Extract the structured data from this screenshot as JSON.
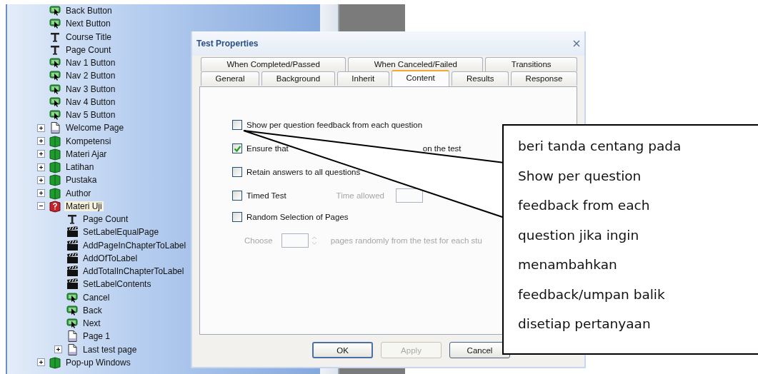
{
  "tree": {
    "items": [
      {
        "label": "Back Button",
        "kind": "button",
        "selected": false
      },
      {
        "label": "Next Button",
        "kind": "button",
        "selected": false
      },
      {
        "label": "Course Title",
        "kind": "text",
        "selected": false
      },
      {
        "label": "Page Count",
        "kind": "text",
        "selected": false
      },
      {
        "label": "Nav 1 Button",
        "kind": "button",
        "selected": false
      },
      {
        "label": "Nav 2 Button",
        "kind": "button",
        "selected": false
      },
      {
        "label": "Nav 3 Button",
        "kind": "button",
        "selected": false
      },
      {
        "label": "Nav 4 Button",
        "kind": "button",
        "selected": false
      },
      {
        "label": "Nav 5 Button",
        "kind": "button",
        "selected": false
      },
      {
        "label": "Welcome Page",
        "kind": "page",
        "expanded": false,
        "selected": false
      },
      {
        "label": "Kompetensi",
        "kind": "chapter",
        "expanded": false,
        "selected": false
      },
      {
        "label": "Materi Ajar",
        "kind": "chapter",
        "expanded": false,
        "selected": false
      },
      {
        "label": "Latihan",
        "kind": "chapter",
        "expanded": false,
        "selected": false
      },
      {
        "label": "Pustaka",
        "kind": "chapter",
        "expanded": false,
        "selected": false
      },
      {
        "label": "Author",
        "kind": "chapter",
        "expanded": false,
        "selected": false
      },
      {
        "label": "Materi Uji",
        "kind": "test",
        "expanded": true,
        "selected": true,
        "children": [
          {
            "label": "Page Count",
            "kind": "text",
            "selected": false
          },
          {
            "label": "SetLabelEqualPage",
            "kind": "action",
            "selected": false
          },
          {
            "label": "AddPageInChapterToLabel",
            "kind": "action",
            "selected": false
          },
          {
            "label": "AddOfToLabel",
            "kind": "action",
            "selected": false
          },
          {
            "label": "AddTotalInChapterToLabel",
            "kind": "action",
            "selected": false
          },
          {
            "label": "SetLabelContents",
            "kind": "action",
            "selected": false
          },
          {
            "label": "Cancel",
            "kind": "button",
            "selected": false
          },
          {
            "label": "Back",
            "kind": "button",
            "selected": false
          },
          {
            "label": "Next",
            "kind": "button",
            "selected": false
          },
          {
            "label": "Page 1",
            "kind": "page",
            "selected": false
          },
          {
            "label": "Last test page",
            "kind": "page",
            "expanded": false,
            "selected": false
          }
        ]
      },
      {
        "label": "Pop-up Windows",
        "kind": "chapter",
        "expanded": false,
        "selected": false
      }
    ]
  },
  "dialog": {
    "title": "Test Properties",
    "tab_rows": [
      [
        {
          "label": "When Completed/Passed",
          "selected": false
        },
        {
          "label": "When Canceled/Failed",
          "selected": false
        },
        {
          "label": "Transitions",
          "selected": false
        }
      ],
      [
        {
          "label": "General",
          "selected": false
        },
        {
          "label": "Background",
          "selected": false
        },
        {
          "label": "Inherit",
          "selected": false
        },
        {
          "label": "Content",
          "selected": true
        },
        {
          "label": "Results",
          "selected": false
        },
        {
          "label": "Response",
          "selected": false
        }
      ]
    ],
    "options": [
      {
        "kind": "checkbox",
        "label_parts": [
          "Show per question feedback from each question"
        ],
        "checked": false
      },
      {
        "kind": "checkbox",
        "label_parts": [
          "Ensure that",
          "on the test"
        ],
        "checked": true
      },
      {
        "kind": "checkbox",
        "label_parts": [
          "Retain answers to all questions"
        ],
        "checked": false
      },
      {
        "kind": "checkbox",
        "label_parts": [
          "Timed Test"
        ],
        "checked": false,
        "extra_label": "Time allowed"
      },
      {
        "kind": "checkbox",
        "label_parts": [
          "Random Selection of Pages"
        ],
        "checked": false
      },
      {
        "kind": "spinner",
        "label": "Choose",
        "suffix": "pages randomly from the test for each stu",
        "disabled": true
      }
    ],
    "buttons": [
      {
        "label": "OK",
        "default": true,
        "disabled": false
      },
      {
        "label": "Apply",
        "default": false,
        "disabled": true
      },
      {
        "label": "Cancel",
        "default": false,
        "disabled": false
      }
    ]
  },
  "callout": {
    "text": "beri tanda centang pada Show per question feedback from each question jika ingin menambahkan feedback/umpan balik disetiap pertanyaan"
  }
}
